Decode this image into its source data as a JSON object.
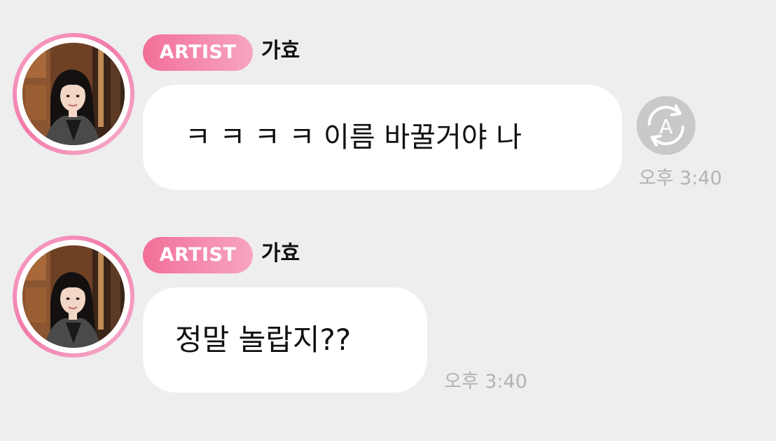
{
  "messages": [
    {
      "badge": "ARTIST",
      "sender": "가효",
      "text": "ㅋ ㅋ ㅋ ㅋ  이름 바꿀거야 나",
      "time": "오후 3:40",
      "translate_icon_letter": "A"
    },
    {
      "badge": "ARTIST",
      "sender": "가효",
      "text": "정말 놀랍지??",
      "time": "오후 3:40"
    }
  ],
  "colors": {
    "background": "#eeeeee",
    "bubble": "#ffffff",
    "badge_start": "#f26f98",
    "badge_end": "#f7a5c1",
    "time": "#b3b3b3",
    "translate_button": "#c9c9c9"
  }
}
